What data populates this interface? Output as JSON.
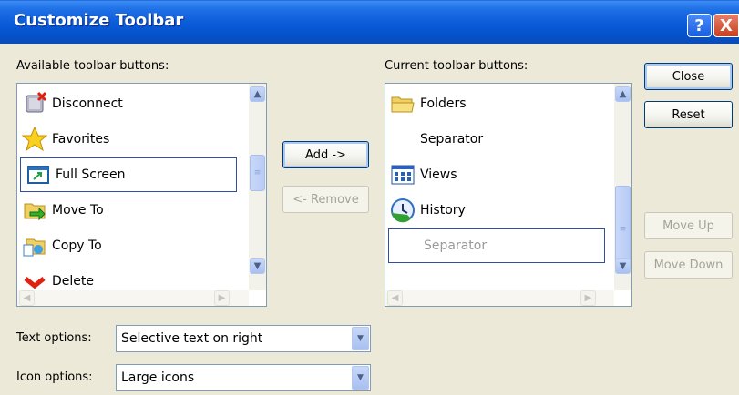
{
  "window": {
    "title": "Customize Toolbar",
    "help_glyph": "?",
    "close_glyph": "X"
  },
  "available": {
    "label": "Available toolbar buttons:",
    "items": [
      {
        "label": "Disconnect",
        "icon": "disconnect-icon"
      },
      {
        "label": "Favorites",
        "icon": "star-icon"
      },
      {
        "label": "Full Screen",
        "icon": "full-screen-icon",
        "selected": true
      },
      {
        "label": "Move To",
        "icon": "move-to-icon"
      },
      {
        "label": "Copy To",
        "icon": "copy-to-icon"
      },
      {
        "label": "Delete",
        "icon": "delete-icon"
      }
    ]
  },
  "current": {
    "label": "Current toolbar buttons:",
    "items": [
      {
        "label": "Folders",
        "icon": "folder-icon"
      },
      {
        "label": "Separator",
        "icon": ""
      },
      {
        "label": "Views",
        "icon": "views-icon"
      },
      {
        "label": "History",
        "icon": "history-icon"
      },
      {
        "label": "Separator",
        "icon": "",
        "selected": true
      }
    ]
  },
  "buttons": {
    "add": "Add ->",
    "remove": "<- Remove",
    "close": "Close",
    "reset": "Reset",
    "move_up": "Move Up",
    "move_down": "Move Down"
  },
  "text_options": {
    "label": "Text options:",
    "value": "Selective text on right"
  },
  "icon_options": {
    "label": "Icon options:",
    "value": "Large icons"
  },
  "colors": {
    "title_bar": "#0a5ad8",
    "dialog_bg": "#ece9d8",
    "selection_border": "#30509f"
  }
}
